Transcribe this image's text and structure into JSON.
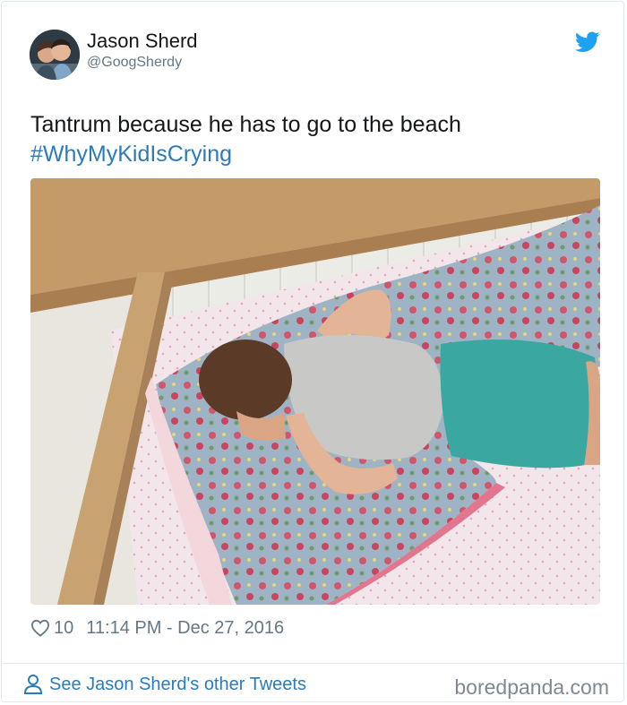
{
  "user": {
    "name": "Jason Sherd",
    "handle": "@GoogSherdy",
    "avatar_icon": "profile-photo"
  },
  "tweet": {
    "text": "Tantrum because he has to go to the beach",
    "hashtag": "#WhyMyKidIsCrying",
    "likes": "10",
    "timestamp": "11:14 PM - Dec 27, 2016"
  },
  "footer": {
    "other_tweets_label": "See Jason Sherd's other Tweets",
    "brand": "boredpanda.com"
  },
  "colors": {
    "link": "#2b7bb9",
    "muted": "#657786",
    "twitter_blue": "#1da1f2"
  }
}
